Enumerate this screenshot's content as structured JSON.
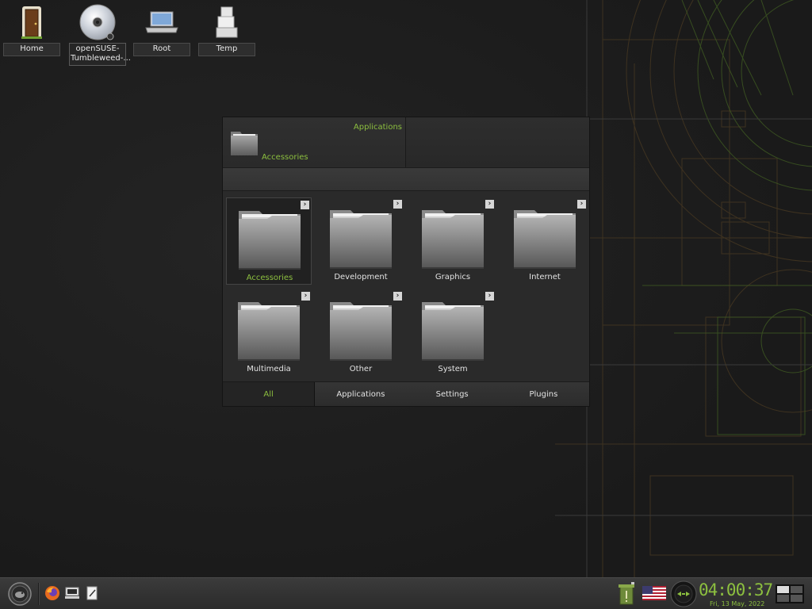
{
  "desktop_icons": [
    {
      "label": "Home",
      "icon": "door-icon"
    },
    {
      "label": "openSUSE-Tumbleweed-...",
      "icon": "cdrom-icon"
    },
    {
      "label": "Root",
      "icon": "laptop-icon"
    },
    {
      "label": "Temp",
      "icon": "boxes-icon"
    }
  ],
  "menu": {
    "header": {
      "title": "Applications",
      "subtitle": "Accessories"
    },
    "categories": [
      {
        "label": "Accessories",
        "selected": true
      },
      {
        "label": "Development"
      },
      {
        "label": "Graphics"
      },
      {
        "label": "Internet"
      },
      {
        "label": "Multimedia"
      },
      {
        "label": "Other"
      },
      {
        "label": "System"
      }
    ],
    "tabs": [
      {
        "label": "All",
        "active": true
      },
      {
        "label": "Applications"
      },
      {
        "label": "Settings"
      },
      {
        "label": "Plugins"
      }
    ]
  },
  "taskbar": {
    "launchers": [
      "firefox-icon",
      "terminal-icon",
      "text-editor-icon"
    ],
    "clock": {
      "time": "04:00:37",
      "date": "Fri, 13 May, 2022"
    },
    "tray": [
      "trash-icon",
      "us-flag-icon",
      "media-player-icon",
      "workspace-switcher-icon"
    ]
  },
  "colors": {
    "accent": "#8cbf3f",
    "background": "#1e1e1e"
  }
}
